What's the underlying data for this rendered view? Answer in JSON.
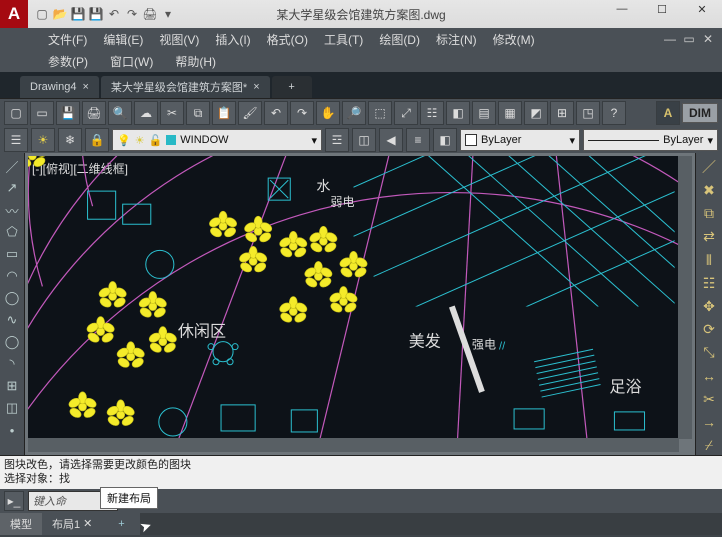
{
  "title": "某大学星级会馆建筑方案图.dwg",
  "menus": {
    "file": "文件(F)",
    "edit": "编辑(E)",
    "view": "视图(V)",
    "insert": "插入(I)",
    "format": "格式(O)",
    "tools": "工具(T)",
    "draw": "绘图(D)",
    "annotate": "标注(N)",
    "modify": "修改(M)"
  },
  "menus2": {
    "params": "参数(P)",
    "window": "窗口(W)",
    "help": "帮助(H)"
  },
  "doc_tabs": {
    "t1": "Drawing4",
    "t2": "某大学星级会馆建筑方案图*"
  },
  "toolbar_label": "DIM",
  "layers": {
    "current": "WINDOW",
    "bylayer": "ByLayer",
    "linetype": "ByLayer"
  },
  "viewport_label": "[-][俯视][二维线框]",
  "canvas_text": {
    "water": "水",
    "weak": "弱电",
    "leisure": "休闲区",
    "beauty": "美发",
    "strong": "强电",
    "bath": "足浴"
  },
  "cmd_hist_1": "图块改色，请选择需要更改颜色的图块",
  "cmd_hist_2": "选择对象：找",
  "cmd_placeholder": "键入命",
  "tooltip": "新建布局",
  "status_tabs": {
    "model": "模型",
    "layout": "布局1"
  }
}
